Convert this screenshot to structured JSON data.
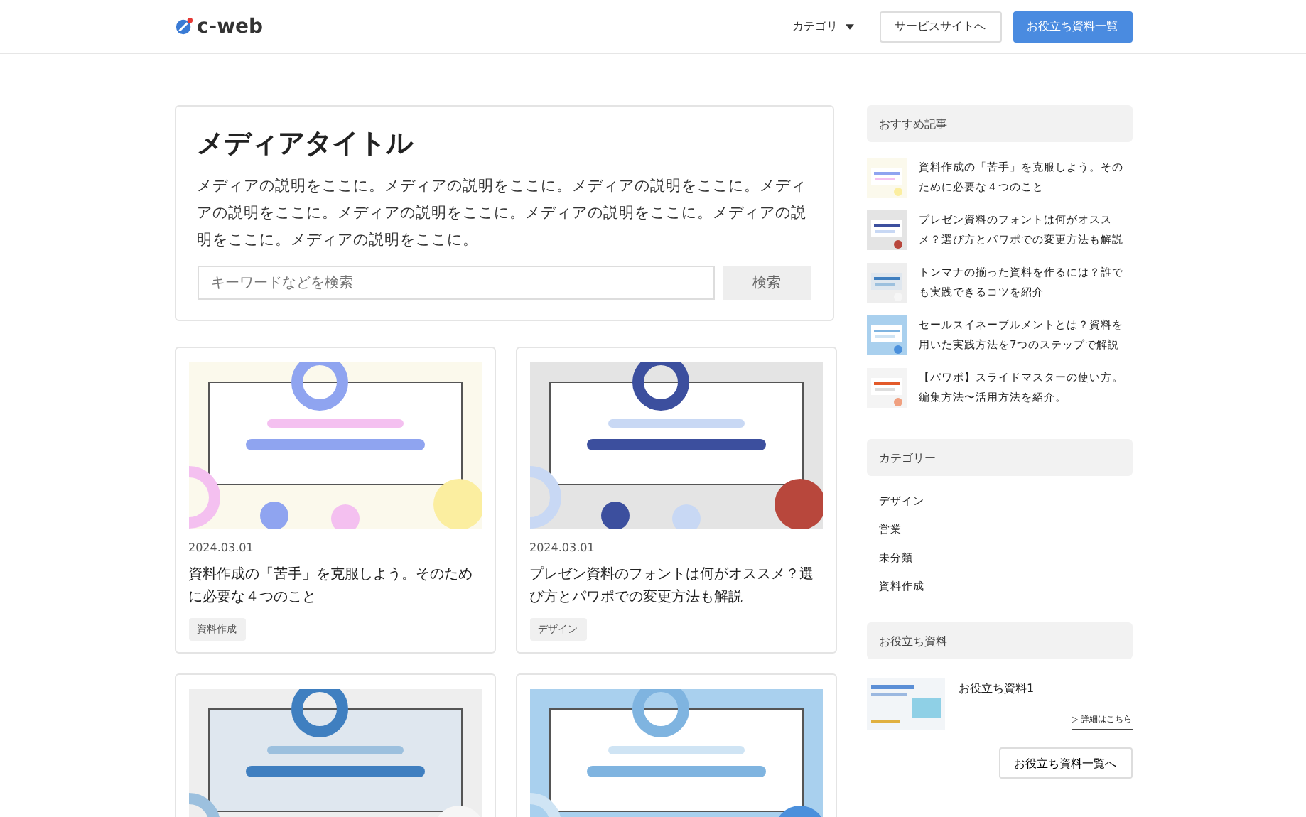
{
  "header": {
    "logo": "c-web",
    "nav": [
      {
        "label": "カテゴリ",
        "kind": "dropdown"
      },
      {
        "label": "サービスサイトへ",
        "kind": "outline"
      },
      {
        "label": "お役立ち資料一覧",
        "kind": "primary"
      }
    ]
  },
  "hero": {
    "title": "メディアタイトル",
    "description": "メディアの説明をここに。メディアの説明をここに。メディアの説明をここに。メディアの説明をここに。メディアの説明をここに。メディアの説明をここに。メディアの説明をここに。メディアの説明をここに。",
    "search": {
      "placeholder": "キーワードなどを検索",
      "button": "検索"
    }
  },
  "articles": [
    {
      "date": "2024.03.01",
      "title": "資料作成の「苦手」を克服しよう。そのために必要な４つのこと",
      "tag": "資料作成",
      "kind": "picture"
    },
    {
      "date": "2024.03.01",
      "title": "プレゼン資料のフォントは何がオススメ？選び方とパワポでの変更方法も解説",
      "tag": "デザイン",
      "kind": "picture"
    },
    {
      "kind": "picture"
    },
    {
      "kind": "picture"
    }
  ],
  "sidebar": {
    "recommended": {
      "heading": "おすすめ記事",
      "items": [
        {
          "title": "資料作成の「苦手」を克服しよう。そのために必要な４つのこと"
        },
        {
          "title": "プレゼン資料のフォントは何がオススメ？選び方とパワポでの変更方法も解説"
        },
        {
          "title": "トンマナの揃った資料を作るには？誰でも実践できるコツを紹介"
        },
        {
          "title": "セールスイネーブルメントとは？資料を用いた実践方法を7つのステップで解説"
        },
        {
          "title": "【パワポ】スライドマスターの使い方。編集方法〜活用方法を紹介。"
        }
      ]
    },
    "categories": {
      "heading": "カテゴリー",
      "items": [
        "デザイン",
        "営業",
        "未分類",
        "資料作成"
      ]
    },
    "resources": {
      "heading": "お役立ち資料",
      "items": [
        {
          "title": "お役立ち資料1",
          "link": "▷ 詳細はこちら"
        }
      ],
      "button": "お役立ち資料一覧へ"
    }
  }
}
